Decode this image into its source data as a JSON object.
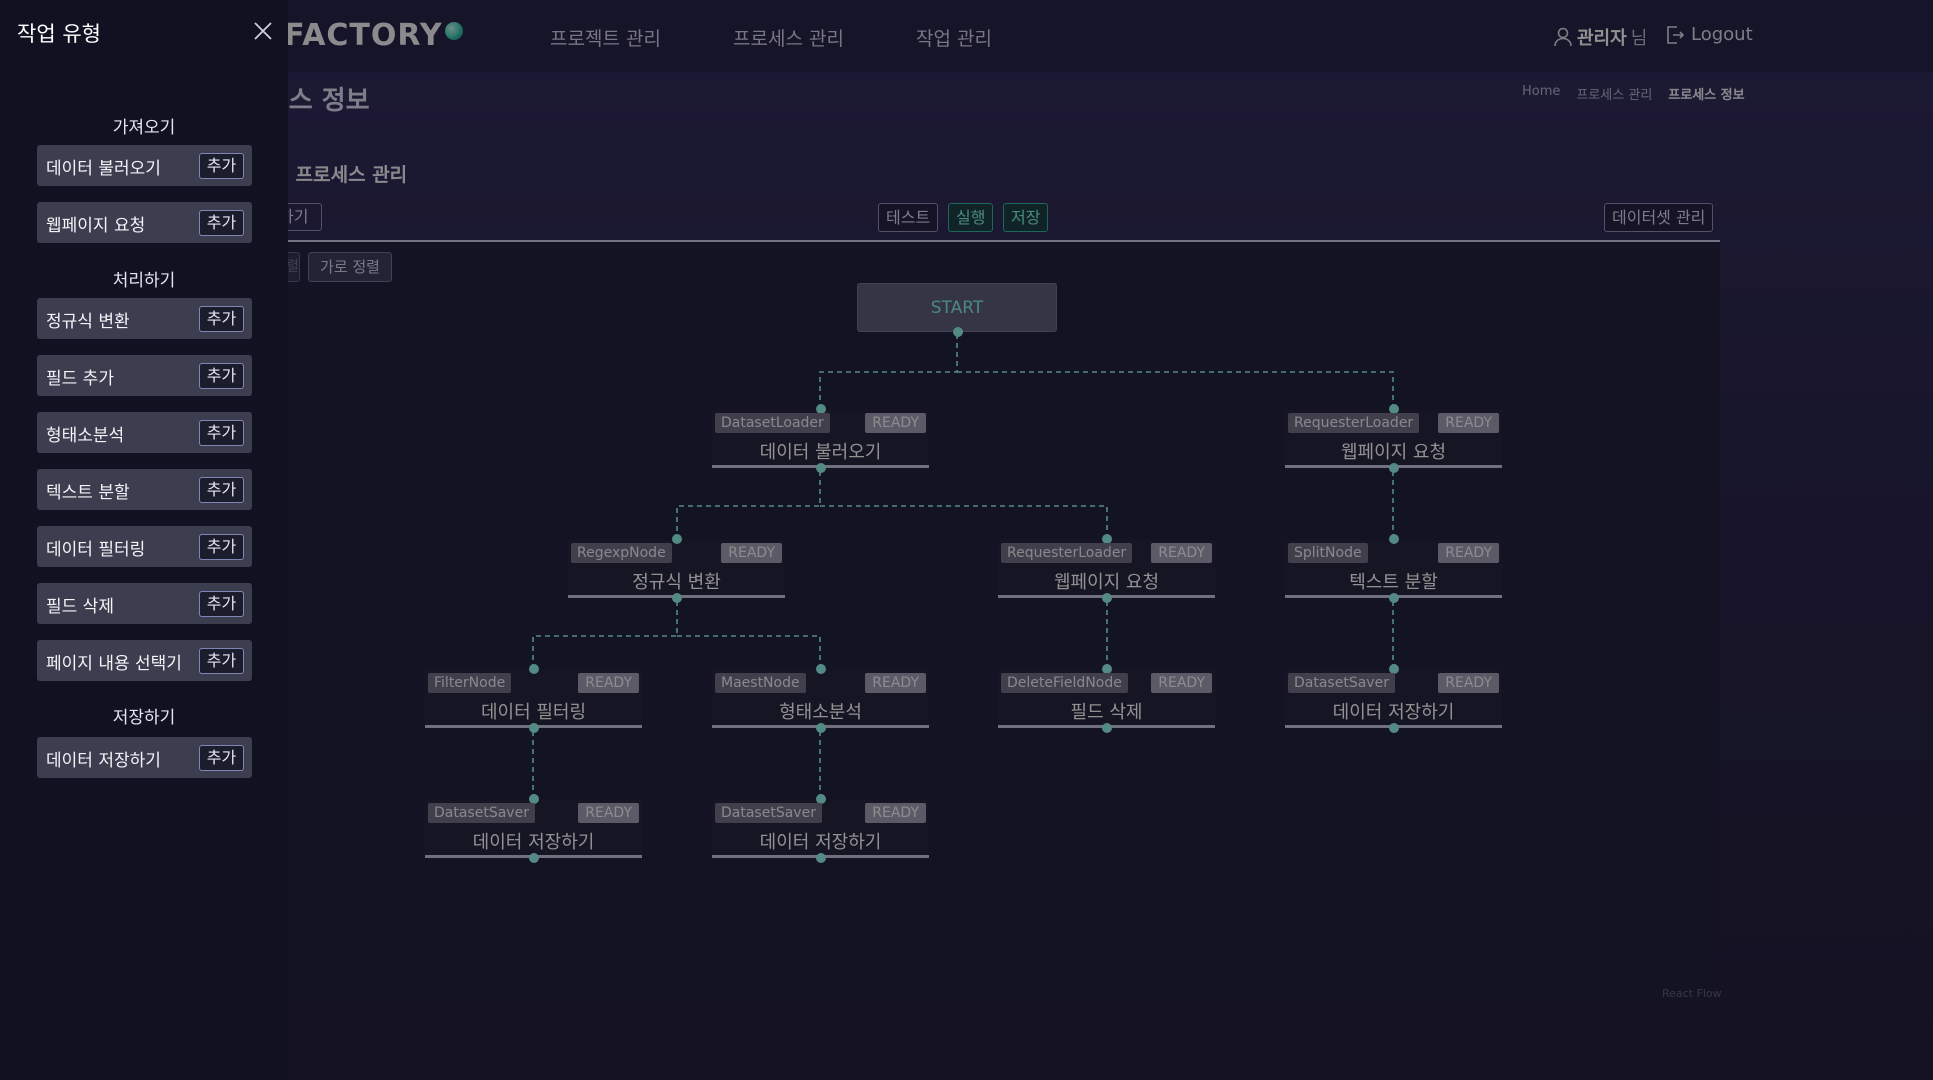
{
  "header": {
    "logo_text": "DATAFACTORY",
    "nav": [
      "프로젝트 관리",
      "프로세스 관리",
      "작업 관리"
    ],
    "user_name": "관리자",
    "user_suffix": "님",
    "logout_label": "Logout"
  },
  "page": {
    "title": "프로세스 정보",
    "breadcrumb": [
      "Home",
      "프로세스 관리",
      "프로세스 정보"
    ],
    "section_title": "티 공정 프로세스 관리",
    "toolbar": {
      "left_fragment": "하기",
      "test_label": "테스트",
      "run_label": "실행",
      "save_label": "저장",
      "dataset_label": "데이터셋 관리",
      "align_v_label": "세로 정렬",
      "align_h_label": "가로 정렬"
    },
    "react_flow_attr": "React Flow"
  },
  "flow": {
    "start_label": "START",
    "nodes": [
      {
        "id": "n1",
        "type": "DatasetLoader",
        "status": "READY",
        "label": "데이터 불러오기"
      },
      {
        "id": "n2",
        "type": "RequesterLoader",
        "status": "READY",
        "label": "웹페이지 요청"
      },
      {
        "id": "n3",
        "type": "RegexpNode",
        "status": "READY",
        "label": "정규식 변환"
      },
      {
        "id": "n4",
        "type": "RequesterLoader",
        "status": "READY",
        "label": "웹페이지 요청"
      },
      {
        "id": "n5",
        "type": "SplitNode",
        "status": "READY",
        "label": "텍스트 분할"
      },
      {
        "id": "n6",
        "type": "FilterNode",
        "status": "READY",
        "label": "데이터 필터링"
      },
      {
        "id": "n7",
        "type": "MaestNode",
        "status": "READY",
        "label": "형태소분석"
      },
      {
        "id": "n8",
        "type": "DeleteFieldNode",
        "status": "READY",
        "label": "필드 삭제"
      },
      {
        "id": "n9",
        "type": "DatasetSaver",
        "status": "READY",
        "label": "데이터 저장하기"
      },
      {
        "id": "n10",
        "type": "DatasetSaver",
        "status": "READY",
        "label": "데이터 저장하기"
      },
      {
        "id": "n11",
        "type": "DatasetSaver",
        "status": "READY",
        "label": "데이터 저장하기"
      }
    ]
  },
  "sidebar": {
    "title": "작업 유형",
    "add_label": "추가",
    "categories": [
      {
        "label": "가져오기",
        "items": [
          "데이터 불러오기",
          "웹페이지 요청"
        ]
      },
      {
        "label": "처리하기",
        "items": [
          "정규식 변환",
          "필드 추가",
          "형태소분석",
          "텍스트 분할",
          "데이터 필터링",
          "필드 삭제",
          "페이지 내용 선택기"
        ]
      },
      {
        "label": "저장하기",
        "items": [
          "데이터 저장하기"
        ]
      }
    ]
  },
  "colors": {
    "accent": "#2fb39d",
    "handle": "#8ff3e3",
    "sidebar_bg": "#101222",
    "canvas_bg": "#1d1a36"
  }
}
